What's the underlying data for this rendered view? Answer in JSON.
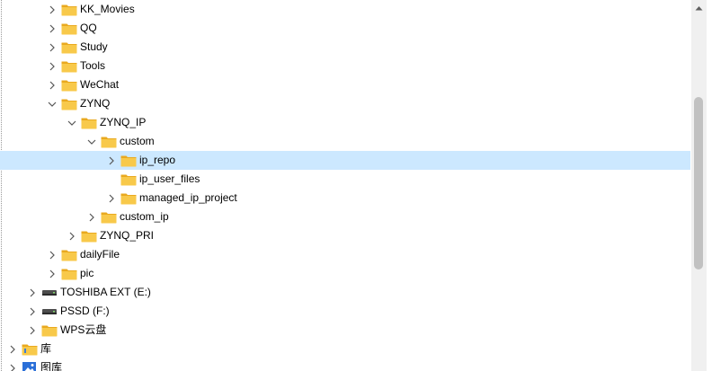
{
  "tree": {
    "items": [
      {
        "label": "KK_Movies",
        "icon": "folder-icon",
        "expander": "collapsed"
      },
      {
        "label": "QQ",
        "icon": "folder-icon",
        "expander": "collapsed"
      },
      {
        "label": "Study",
        "icon": "folder-icon",
        "expander": "collapsed"
      },
      {
        "label": "Tools",
        "icon": "folder-icon",
        "expander": "collapsed"
      },
      {
        "label": "WeChat",
        "icon": "folder-icon",
        "expander": "collapsed"
      },
      {
        "label": "ZYNQ",
        "icon": "folder-icon",
        "expander": "expanded"
      },
      {
        "label": "ZYNQ_IP",
        "icon": "folder-icon",
        "expander": "expanded"
      },
      {
        "label": "custom",
        "icon": "folder-icon",
        "expander": "expanded"
      },
      {
        "label": "ip_repo",
        "icon": "folder-icon",
        "expander": "collapsed",
        "selected": true
      },
      {
        "label": "ip_user_files",
        "icon": "folder-icon",
        "expander": "none"
      },
      {
        "label": "managed_ip_project",
        "icon": "folder-icon",
        "expander": "collapsed"
      },
      {
        "label": "custom_ip",
        "icon": "folder-icon",
        "expander": "collapsed"
      },
      {
        "label": "ZYNQ_PRI",
        "icon": "folder-icon",
        "expander": "collapsed"
      },
      {
        "label": "dailyFile",
        "icon": "folder-icon",
        "expander": "collapsed"
      },
      {
        "label": "pic",
        "icon": "folder-icon",
        "expander": "collapsed"
      },
      {
        "label": "TOSHIBA EXT (E:)",
        "icon": "drive-icon",
        "expander": "collapsed"
      },
      {
        "label": "PSSD (F:)",
        "icon": "drive-icon",
        "expander": "collapsed"
      },
      {
        "label": "WPS云盘",
        "icon": "folder-icon",
        "expander": "collapsed"
      },
      {
        "label": "库",
        "icon": "library-folder-icon",
        "expander": "collapsed"
      },
      {
        "label": "图库",
        "icon": "gallery-icon",
        "expander": "collapsed"
      }
    ]
  },
  "colors": {
    "selection": "#cce8ff",
    "folder_body": "#f8c94a",
    "folder_tab": "#e9a91f",
    "scrollbar_track": "#f0f0f0",
    "scrollbar_thumb": "#c1c1c1"
  }
}
